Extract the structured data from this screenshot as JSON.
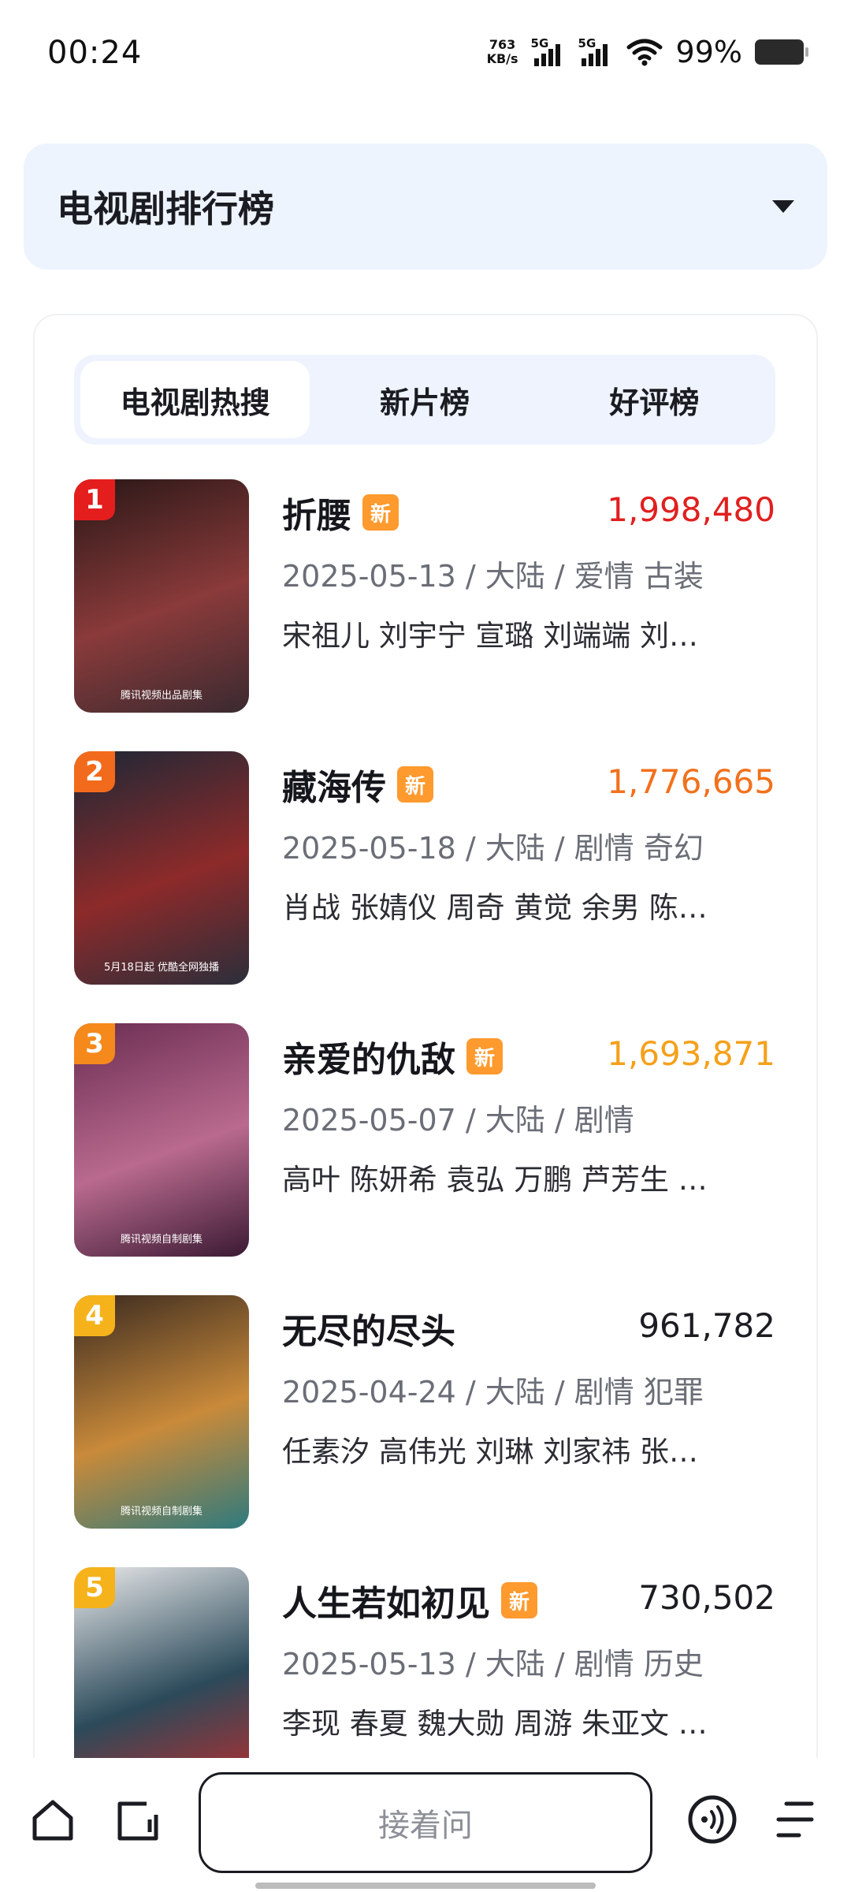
{
  "status_bar": {
    "time": "00:24",
    "net_speed_value": "763",
    "net_speed_unit": "KB/s",
    "signal1_label": "5G",
    "signal2_label": "5G",
    "battery_text": "99%"
  },
  "dropdown": {
    "title": "电视剧排行榜"
  },
  "tabs": [
    {
      "label": "电视剧热搜",
      "active": true
    },
    {
      "label": "新片榜",
      "active": false
    },
    {
      "label": "好评榜",
      "active": false
    }
  ],
  "list": [
    {
      "rank": "1",
      "title": "折腰",
      "is_new": true,
      "new_label": "新",
      "score": "1,998,480",
      "score_color": "#e0201f",
      "rank_color": "#e41d1d",
      "meta": "2025-05-13 / 大陆 / 爱情 古装",
      "cast": "宋祖儿 刘宇宁 宣璐 刘端端 刘…",
      "poster_caption": "腾讯视频出品剧集",
      "poster_colors": [
        "#2a1717",
        "#8a3a3a",
        "#3a2a30"
      ]
    },
    {
      "rank": "2",
      "title": "藏海传",
      "is_new": true,
      "new_label": "新",
      "score": "1,776,665",
      "score_color": "#f2711c",
      "rank_color": "#f26a1b",
      "meta": "2025-05-18 / 大陆 / 剧情 奇幻",
      "cast": "肖战 张婧仪 周奇 黄觉 余男 陈…",
      "poster_caption": "5月18日起 优酷全网独播",
      "poster_colors": [
        "#1d2836",
        "#8d2a2a",
        "#2b2e3a"
      ]
    },
    {
      "rank": "3",
      "title": "亲爱的仇敌",
      "is_new": true,
      "new_label": "新",
      "score": "1,693,871",
      "score_color": "#f5a01b",
      "rank_color": "#f5891b",
      "meta": "2025-05-07 / 大陆 / 剧情",
      "cast": "高叶 陈妍希 袁弘 万鹏 芦芳生 …",
      "poster_caption": "腾讯视频自制剧集",
      "poster_colors": [
        "#6b2d52",
        "#b96a8e",
        "#3b1a33"
      ]
    },
    {
      "rank": "4",
      "title": "无尽的尽头",
      "is_new": false,
      "new_label": "",
      "score": "961,782",
      "score_color": "#1c1d22",
      "rank_color": "#f5b21b",
      "meta": "2025-04-24 / 大陆 / 剧情 犯罪",
      "cast": "任素汐 高伟光 刘琳 刘家祎 张…",
      "poster_caption": "腾讯视频自制剧集",
      "poster_colors": [
        "#3a2a20",
        "#c98a3a",
        "#2e7a7e"
      ]
    },
    {
      "rank": "5",
      "title": "人生若如初见",
      "is_new": true,
      "new_label": "新",
      "score": "730,502",
      "score_color": "#1c1d22",
      "rank_color": "#f5b21b",
      "meta": "2025-05-13 / 大陆 / 剧情 历史",
      "cast": "李现 春夏 魏大勋 周游 朱亚文 …",
      "poster_caption": "",
      "poster_colors": [
        "#e9e9ea",
        "#2b4a5a",
        "#c22b2b"
      ]
    }
  ],
  "bottom_bar": {
    "ask_placeholder": "接着问"
  }
}
